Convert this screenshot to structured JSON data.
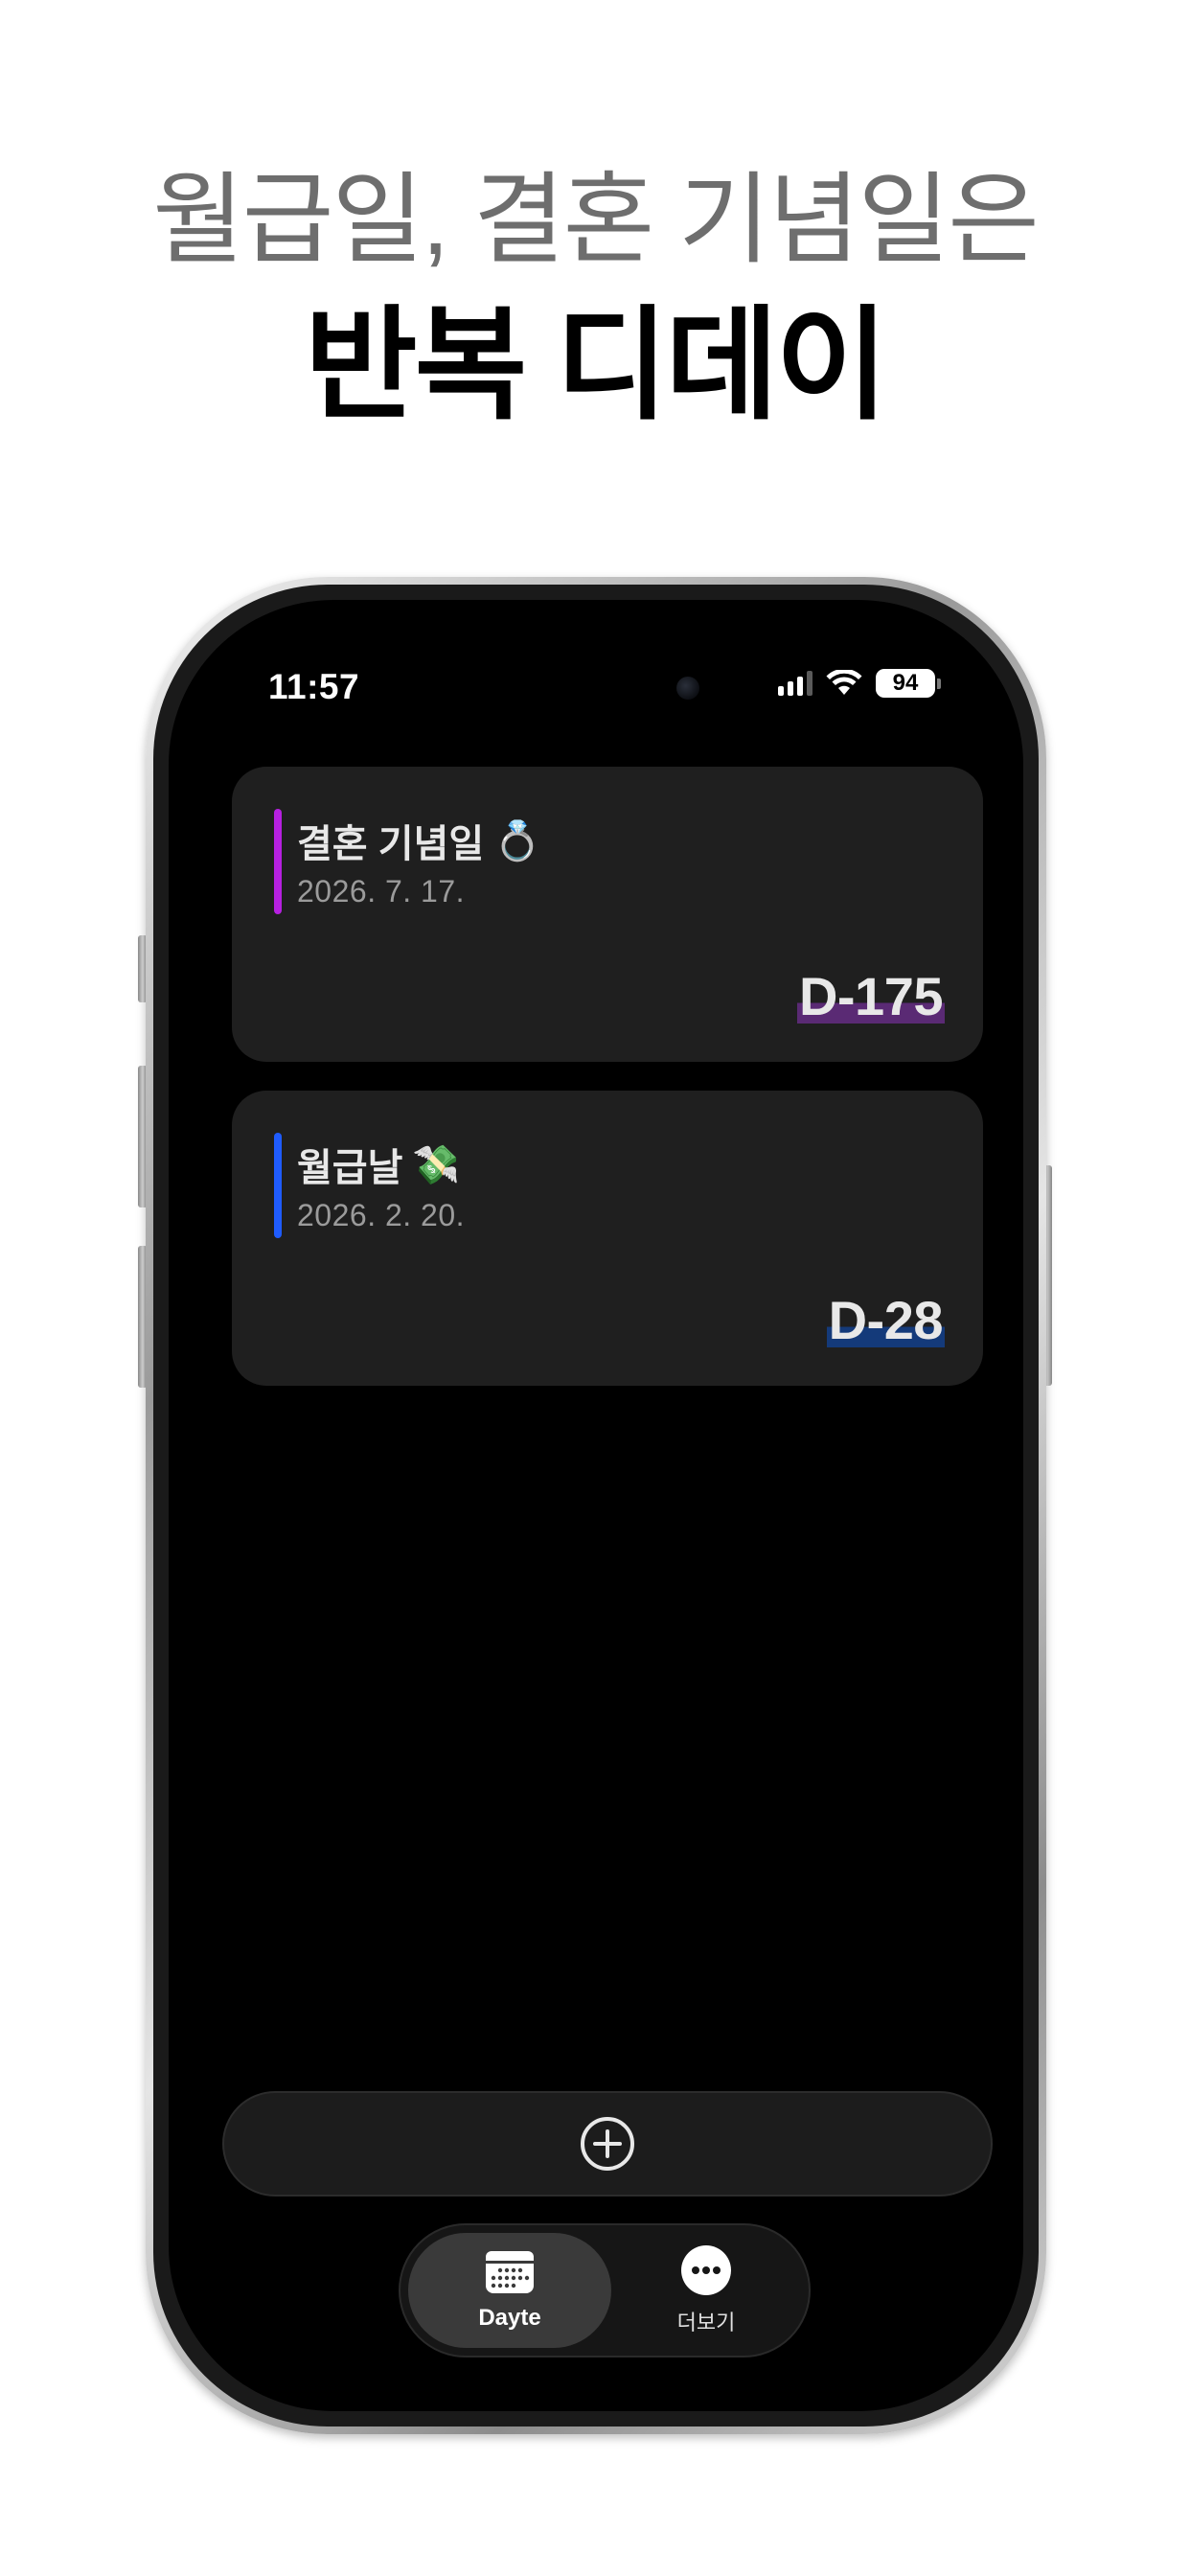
{
  "headline": {
    "line1": "월급일, 결혼 기념일은",
    "line2": "반복 디데이"
  },
  "status_bar": {
    "time": "11:57",
    "battery": "94",
    "icons": [
      "cellular-signal-icon",
      "wifi-icon",
      "battery-icon"
    ]
  },
  "events": [
    {
      "title": "결혼 기념일",
      "emoji": "💍",
      "date": "2026. 7. 17.",
      "dday": "D-175",
      "accent_color": "#b620e0",
      "highlight_color": "#5a2a74"
    },
    {
      "title": "월급날",
      "emoji": "💸",
      "date": "2026. 2. 20.",
      "dday": "D-28",
      "accent_color": "#1f5cff",
      "highlight_color": "#143a7a"
    }
  ],
  "add_button": {
    "icon": "plus-circle-icon"
  },
  "tab_bar": {
    "tabs": [
      {
        "label": "Dayte",
        "icon": "calendar-icon",
        "active": true
      },
      {
        "label": "더보기",
        "icon": "more-icon",
        "active": false
      }
    ]
  }
}
